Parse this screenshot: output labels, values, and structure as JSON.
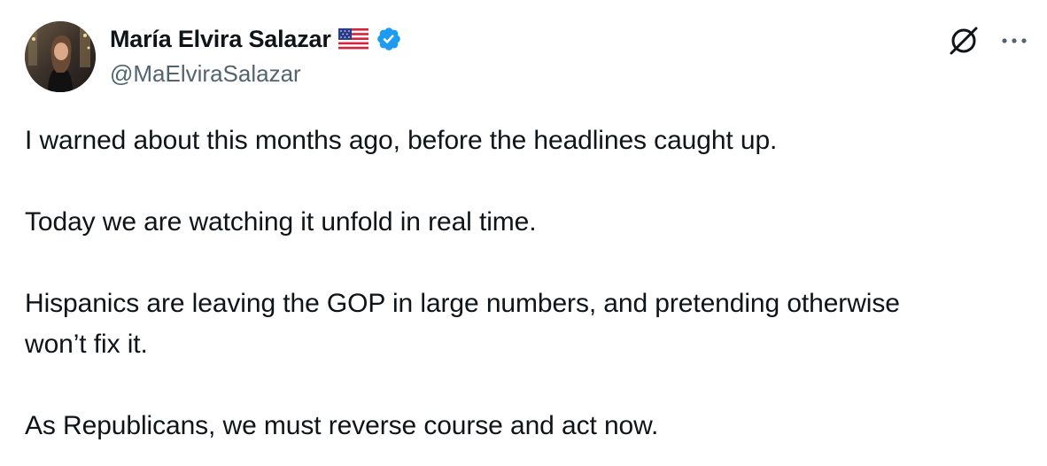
{
  "author": {
    "display_name": "María Elvira Salazar",
    "handle": "@MaElviraSalazar",
    "flag_icon": "us-flag-icon",
    "verified_icon": "verified-badge-icon",
    "verified_color": "#1d9bf0"
  },
  "actions": {
    "grok_icon": "grok-icon",
    "more_icon": "more-dots-icon"
  },
  "tweet": {
    "paragraphs": [
      "I warned about this months ago, before the headlines caught up.",
      "Today we are watching it unfold in real time.",
      "Hispanics are leaving the GOP in large numbers, and pretending otherwise won’t fix it.",
      "As Republicans, we must reverse course and act now."
    ]
  }
}
